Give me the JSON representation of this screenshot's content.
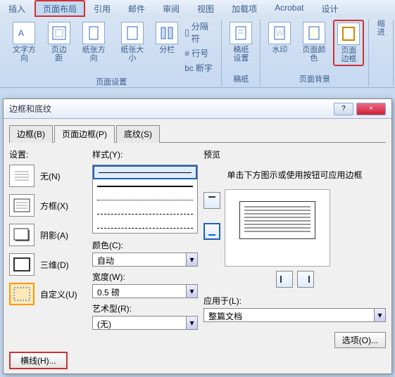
{
  "ribbon": {
    "tabs": [
      "插入",
      "页面布局",
      "引用",
      "邮件",
      "审阅",
      "视图",
      "加载项",
      "Acrobat",
      "设计"
    ],
    "active_tab_index": 1,
    "groups": {
      "page_setup": {
        "label": "页面设置",
        "buttons": {
          "text_dir": "文字方向",
          "margins": "页边距",
          "orientation": "纸张方向",
          "size": "纸张大小",
          "columns": "分栏"
        },
        "small": {
          "breaks": "分隔符",
          "line_no": "行号",
          "hyphen": "断字"
        }
      },
      "paper": {
        "label": "稿纸",
        "btn": "稿纸\n设置"
      },
      "page_bg": {
        "label": "页面背景",
        "watermark": "水印",
        "page_color": "页面颜色",
        "page_border": "页面\n边框"
      },
      "indent": {
        "label": "缩进"
      }
    }
  },
  "dialog": {
    "title": "边框和底纹",
    "tabs": {
      "border": "边框(B)",
      "page_border": "页面边框(P)",
      "shading": "底纹(S)"
    },
    "active_tab": "page_border",
    "settings": {
      "label": "设置:",
      "none": "无(N)",
      "box": "方框(X)",
      "shadow": "阴影(A)",
      "three_d": "三维(D)",
      "custom": "自定义(U)"
    },
    "style": {
      "label": "样式(Y):"
    },
    "color": {
      "label": "颜色(C):",
      "value": "自动"
    },
    "width": {
      "label": "宽度(W):",
      "value": "0.5 磅"
    },
    "art": {
      "label": "艺术型(R):",
      "value": "(无)"
    },
    "preview": {
      "label": "预览",
      "hint": "单击下方图示或使用按钮可应用边框"
    },
    "apply_to": {
      "label": "应用于(L):",
      "value": "整篇文档"
    },
    "options_btn": "选项(O)...",
    "hline_btn": "横线(H)...",
    "help": "?",
    "close": "×"
  }
}
